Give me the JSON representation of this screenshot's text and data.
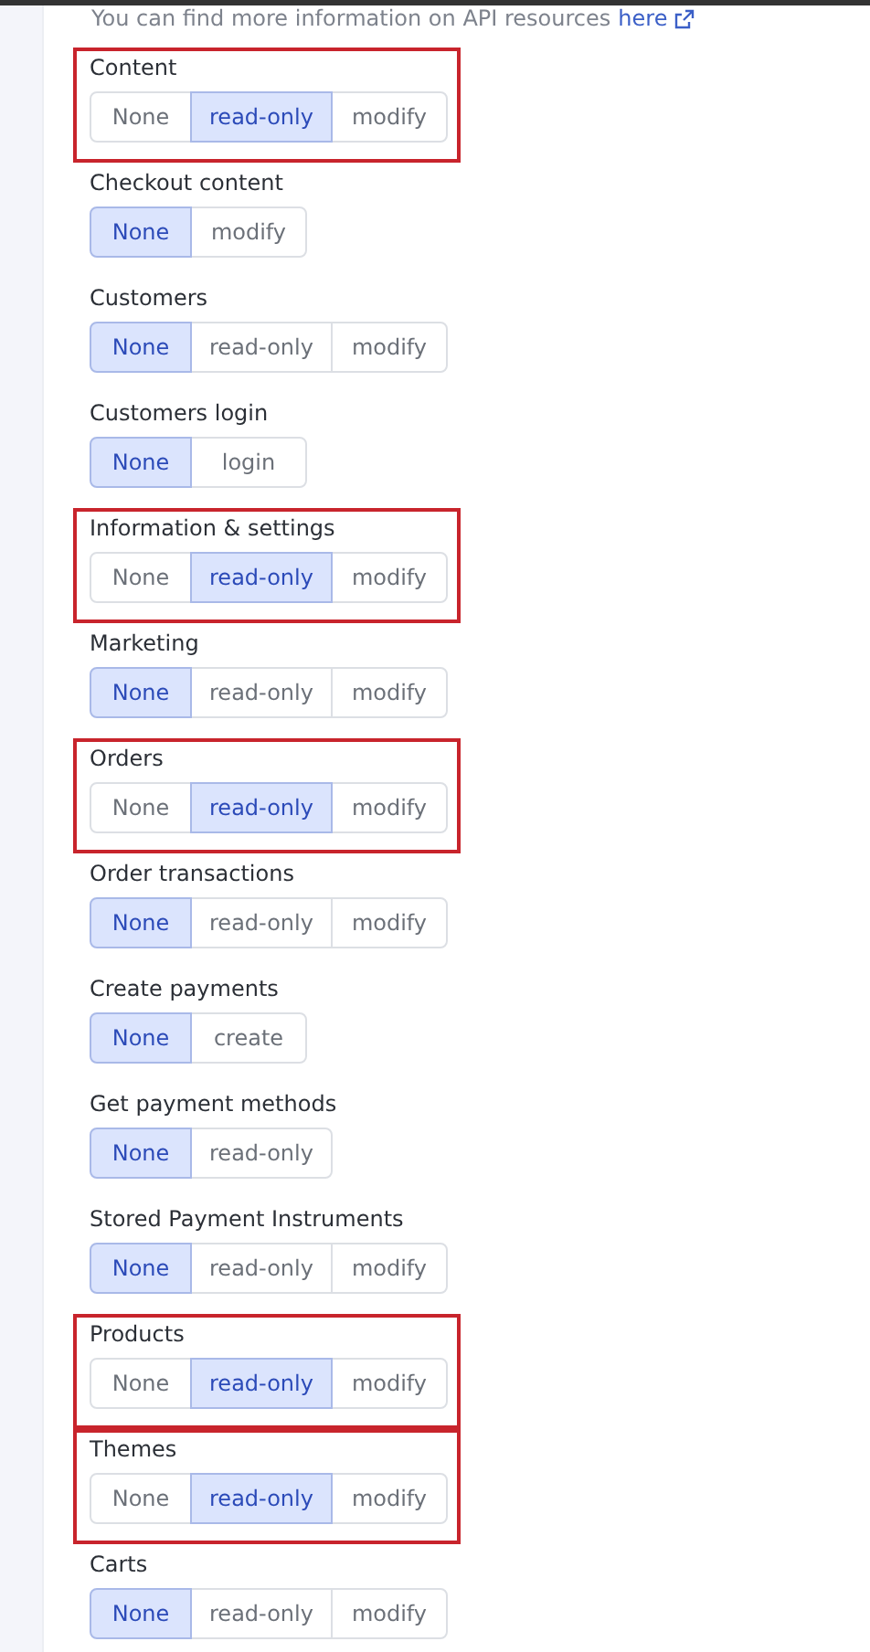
{
  "intro": {
    "text": "You can find more information on API resources",
    "link": "here"
  },
  "scopes": [
    {
      "label": "Content",
      "highlighted": true,
      "options": [
        {
          "label": "None",
          "selected": false
        },
        {
          "label": "read-only",
          "selected": true
        },
        {
          "label": "modify",
          "selected": false
        }
      ]
    },
    {
      "label": "Checkout content",
      "highlighted": false,
      "options": [
        {
          "label": "None",
          "selected": true
        },
        {
          "label": "modify",
          "selected": false
        }
      ]
    },
    {
      "label": "Customers",
      "highlighted": false,
      "options": [
        {
          "label": "None",
          "selected": true
        },
        {
          "label": "read-only",
          "selected": false
        },
        {
          "label": "modify",
          "selected": false
        }
      ]
    },
    {
      "label": "Customers login",
      "highlighted": false,
      "options": [
        {
          "label": "None",
          "selected": true
        },
        {
          "label": "login",
          "selected": false
        }
      ]
    },
    {
      "label": "Information & settings",
      "highlighted": true,
      "options": [
        {
          "label": "None",
          "selected": false
        },
        {
          "label": "read-only",
          "selected": true
        },
        {
          "label": "modify",
          "selected": false
        }
      ]
    },
    {
      "label": "Marketing",
      "highlighted": false,
      "options": [
        {
          "label": "None",
          "selected": true
        },
        {
          "label": "read-only",
          "selected": false
        },
        {
          "label": "modify",
          "selected": false
        }
      ]
    },
    {
      "label": "Orders",
      "highlighted": true,
      "options": [
        {
          "label": "None",
          "selected": false
        },
        {
          "label": "read-only",
          "selected": true
        },
        {
          "label": "modify",
          "selected": false
        }
      ]
    },
    {
      "label": "Order transactions",
      "highlighted": false,
      "options": [
        {
          "label": "None",
          "selected": true
        },
        {
          "label": "read-only",
          "selected": false
        },
        {
          "label": "modify",
          "selected": false
        }
      ]
    },
    {
      "label": "Create payments",
      "highlighted": false,
      "options": [
        {
          "label": "None",
          "selected": true
        },
        {
          "label": "create",
          "selected": false
        }
      ]
    },
    {
      "label": "Get payment methods",
      "highlighted": false,
      "options": [
        {
          "label": "None",
          "selected": true
        },
        {
          "label": "read-only",
          "selected": false
        }
      ]
    },
    {
      "label": "Stored Payment Instruments",
      "highlighted": false,
      "options": [
        {
          "label": "None",
          "selected": true
        },
        {
          "label": "read-only",
          "selected": false
        },
        {
          "label": "modify",
          "selected": false
        }
      ]
    },
    {
      "label": "Products",
      "highlighted": true,
      "options": [
        {
          "label": "None",
          "selected": false
        },
        {
          "label": "read-only",
          "selected": true
        },
        {
          "label": "modify",
          "selected": false
        }
      ]
    },
    {
      "label": "Themes",
      "highlighted": true,
      "options": [
        {
          "label": "None",
          "selected": false
        },
        {
          "label": "read-only",
          "selected": true
        },
        {
          "label": "modify",
          "selected": false
        }
      ]
    },
    {
      "label": "Carts",
      "highlighted": false,
      "options": [
        {
          "label": "None",
          "selected": true
        },
        {
          "label": "read-only",
          "selected": false
        },
        {
          "label": "modify",
          "selected": false
        }
      ]
    }
  ]
}
